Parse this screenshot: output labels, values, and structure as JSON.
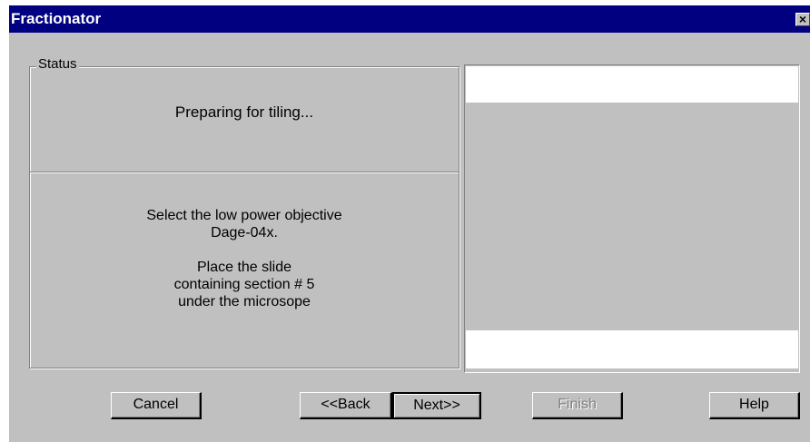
{
  "window": {
    "title": "Fractionator",
    "close_glyph": "×",
    "close_icon": "close-icon",
    "title_bar_color": "#000080",
    "face_color": "#c0c0c0"
  },
  "status_group": {
    "label": "Status",
    "status_text": "Preparing for tiling...",
    "instructions": [
      "Select the low power objective",
      "Dage-04x.",
      "",
      "Place the slide",
      "containing section # 5",
      "under the microsope"
    ]
  },
  "buttons": {
    "cancel": "Cancel",
    "back": "<<Back",
    "next": "Next>>",
    "finish": "Finish",
    "help": "Help"
  }
}
